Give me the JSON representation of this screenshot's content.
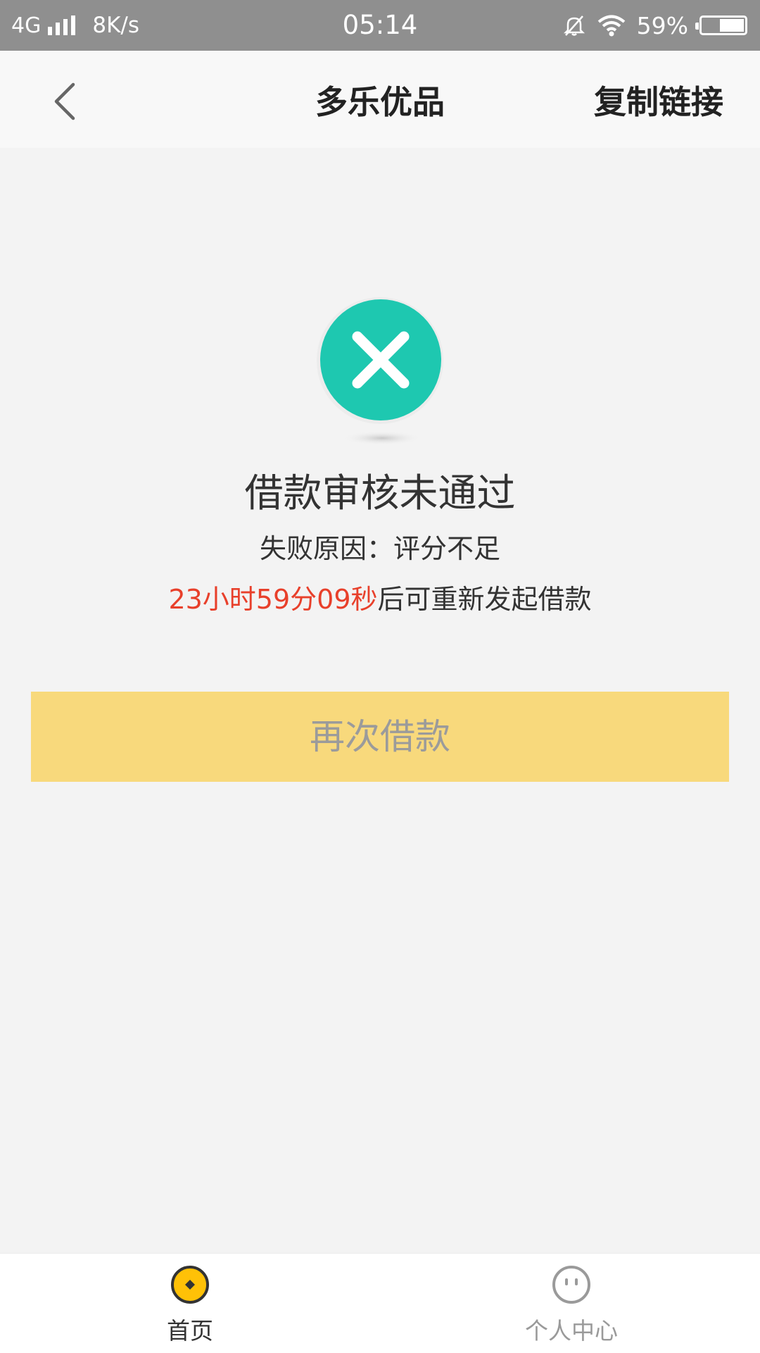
{
  "status_bar": {
    "network": "4G",
    "speed": "8K/s",
    "time": "05:14",
    "battery": "59%",
    "battery_level": 0.59,
    "icons": [
      "signal-icon",
      "mute-bell-icon",
      "wifi-icon",
      "battery-icon"
    ]
  },
  "navbar": {
    "back_icon": "chevron-left-icon",
    "title": "多乐优品",
    "copy_link_label": "复制链接"
  },
  "result": {
    "icon": "close-circle-icon",
    "title": "借款审核未通过",
    "reason": "失败原因：评分不足",
    "countdown": "23小时59分09秒",
    "countdown_suffix": "后可重新发起借款"
  },
  "actions": {
    "retry_label": "再次借款"
  },
  "tabbar": {
    "home_label": "首页",
    "me_label": "个人中心"
  },
  "colors": {
    "status_bar": "#8f8f8f",
    "icon_green": "#1ec8b0",
    "button_yellow": "#f8d97c",
    "countdown_red": "#e8402b",
    "tab_active": "#ffc107"
  }
}
